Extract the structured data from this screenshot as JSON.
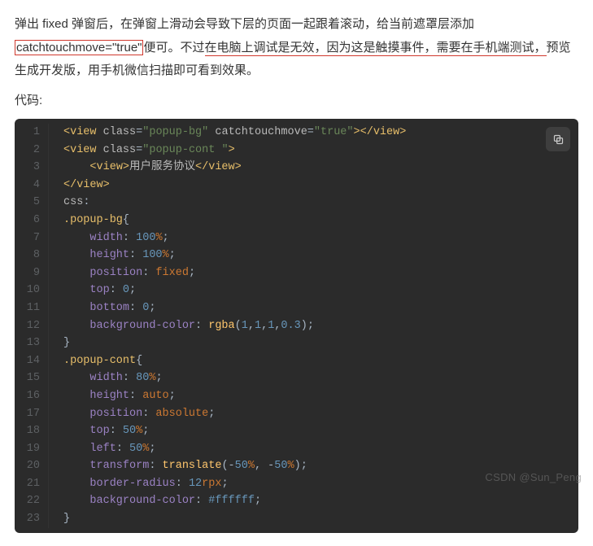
{
  "prose": {
    "seg1": "弹出 fixed 弹窗后，在弹窗上滑动会导致下层的页面一起跟着滚动，给当前遮罩层添加",
    "boxed": "catchtouchmove=\"true\"",
    "seg2": "便可。不过",
    "under1": "在电脑上调试是无效，因为这是触摸事件，",
    "under2": "需要在手机端测试，",
    "seg4": "预览生成开发版，用手机微信扫描即可看到效果。",
    "codelabel": "代码:"
  },
  "code": {
    "lines": [
      [
        [
          "punc",
          "<"
        ],
        [
          "tag",
          "view"
        ],
        [
          "txt",
          " "
        ],
        [
          "attr",
          "class"
        ],
        [
          "p2",
          "="
        ],
        [
          "str",
          "\"popup-bg\""
        ],
        [
          "txt",
          " "
        ],
        [
          "attr",
          "catchtouchmove"
        ],
        [
          "p2",
          "="
        ],
        [
          "str",
          "\"true\""
        ],
        [
          "punc",
          "></"
        ],
        [
          "tag",
          "view"
        ],
        [
          "punc",
          ">"
        ]
      ],
      [
        [
          "punc",
          "<"
        ],
        [
          "tag",
          "view"
        ],
        [
          "txt",
          " "
        ],
        [
          "attr",
          "class"
        ],
        [
          "p2",
          "="
        ],
        [
          "str",
          "\"popup-cont \""
        ],
        [
          "punc",
          ">"
        ]
      ],
      [
        [
          "txt",
          "    "
        ],
        [
          "punc",
          "<"
        ],
        [
          "tag",
          "view"
        ],
        [
          "punc",
          ">"
        ],
        [
          "txt",
          "用户服务协议"
        ],
        [
          "punc",
          "</"
        ],
        [
          "tag",
          "view"
        ],
        [
          "punc",
          ">"
        ]
      ],
      [
        [
          "punc",
          "</"
        ],
        [
          "tag",
          "view"
        ],
        [
          "punc",
          ">"
        ]
      ],
      [
        [
          "txt",
          "css"
        ],
        [
          "p2",
          ":"
        ]
      ],
      [
        [
          "sel",
          ".popup-bg"
        ],
        [
          "p2",
          "{"
        ]
      ],
      [
        [
          "txt",
          "    "
        ],
        [
          "prop",
          "width"
        ],
        [
          "p2",
          ": "
        ],
        [
          "num",
          "100"
        ],
        [
          "unit",
          "%"
        ],
        [
          "p2",
          ";"
        ]
      ],
      [
        [
          "txt",
          "    "
        ],
        [
          "prop",
          "height"
        ],
        [
          "p2",
          ": "
        ],
        [
          "num",
          "100"
        ],
        [
          "unit",
          "%"
        ],
        [
          "p2",
          ";"
        ]
      ],
      [
        [
          "txt",
          "    "
        ],
        [
          "prop",
          "position"
        ],
        [
          "p2",
          ": "
        ],
        [
          "kw",
          "fixed"
        ],
        [
          "p2",
          ";"
        ]
      ],
      [
        [
          "txt",
          "    "
        ],
        [
          "prop",
          "top"
        ],
        [
          "p2",
          ": "
        ],
        [
          "num",
          "0"
        ],
        [
          "p2",
          ";"
        ]
      ],
      [
        [
          "txt",
          "    "
        ],
        [
          "prop",
          "bottom"
        ],
        [
          "p2",
          ": "
        ],
        [
          "num",
          "0"
        ],
        [
          "p2",
          ";"
        ]
      ],
      [
        [
          "txt",
          "    "
        ],
        [
          "prop",
          "background-color"
        ],
        [
          "p2",
          ": "
        ],
        [
          "func",
          "rgba"
        ],
        [
          "p2",
          "("
        ],
        [
          "num",
          "1"
        ],
        [
          "p2",
          ","
        ],
        [
          "num",
          "1"
        ],
        [
          "p2",
          ","
        ],
        [
          "num",
          "1"
        ],
        [
          "p2",
          ","
        ],
        [
          "num",
          "0.3"
        ],
        [
          "p2",
          ");"
        ]
      ],
      [
        [
          "p2",
          "}"
        ]
      ],
      [
        [
          "sel",
          ".popup-cont"
        ],
        [
          "p2",
          "{"
        ]
      ],
      [
        [
          "txt",
          "    "
        ],
        [
          "prop",
          "width"
        ],
        [
          "p2",
          ": "
        ],
        [
          "num",
          "80"
        ],
        [
          "unit",
          "%"
        ],
        [
          "p2",
          ";"
        ]
      ],
      [
        [
          "txt",
          "    "
        ],
        [
          "prop",
          "height"
        ],
        [
          "p2",
          ": "
        ],
        [
          "kw",
          "auto"
        ],
        [
          "p2",
          ";"
        ]
      ],
      [
        [
          "txt",
          "    "
        ],
        [
          "prop",
          "position"
        ],
        [
          "p2",
          ": "
        ],
        [
          "kw",
          "absolute"
        ],
        [
          "p2",
          ";"
        ]
      ],
      [
        [
          "txt",
          "    "
        ],
        [
          "prop",
          "top"
        ],
        [
          "p2",
          ": "
        ],
        [
          "num",
          "50"
        ],
        [
          "unit",
          "%"
        ],
        [
          "p2",
          ";"
        ]
      ],
      [
        [
          "txt",
          "    "
        ],
        [
          "prop",
          "left"
        ],
        [
          "p2",
          ": "
        ],
        [
          "num",
          "50"
        ],
        [
          "unit",
          "%"
        ],
        [
          "p2",
          ";"
        ]
      ],
      [
        [
          "txt",
          "    "
        ],
        [
          "prop",
          "transform"
        ],
        [
          "p2",
          ": "
        ],
        [
          "func",
          "translate"
        ],
        [
          "p2",
          "(-"
        ],
        [
          "num",
          "50"
        ],
        [
          "unit",
          "%"
        ],
        [
          "p2",
          ", -"
        ],
        [
          "num",
          "50"
        ],
        [
          "unit",
          "%"
        ],
        [
          "p2",
          ");"
        ]
      ],
      [
        [
          "txt",
          "    "
        ],
        [
          "prop",
          "border-radius"
        ],
        [
          "p2",
          ": "
        ],
        [
          "num",
          "12"
        ],
        [
          "unit",
          "rpx"
        ],
        [
          "p2",
          ";"
        ]
      ],
      [
        [
          "txt",
          "    "
        ],
        [
          "prop",
          "background-color"
        ],
        [
          "p2",
          ": "
        ],
        [
          "num",
          "#ffffff"
        ],
        [
          "p2",
          ";"
        ]
      ],
      [
        [
          "p2",
          "}"
        ]
      ]
    ]
  },
  "watermark": "CSDN @Sun_Peng"
}
